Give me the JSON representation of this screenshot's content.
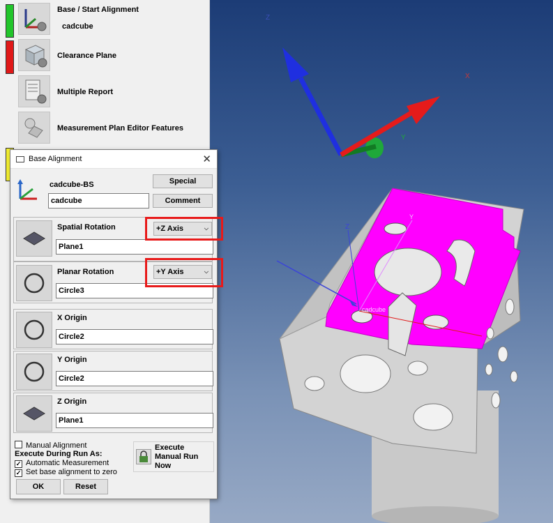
{
  "plan_editor": {
    "items": [
      {
        "label": "Base / Start Alignment",
        "sublabel": "cadcube",
        "status_color": "#22c52b",
        "icon": "alignment-axes-icon"
      },
      {
        "label": "Clearance Plane",
        "status_color": "#e01818",
        "icon": "clearance-cube-icon"
      },
      {
        "label": "Multiple Report",
        "icon": "report-icon"
      },
      {
        "label": "Measurement Plan Editor Features",
        "icon": "features-icon"
      }
    ],
    "hidden_status_color": "#f2ee30"
  },
  "dialog": {
    "title": "Base Alignment",
    "alignment_name": "cadcube-BS",
    "comment_value": "cadcube",
    "special_button": "Special",
    "comment_button": "Comment",
    "spatial_rotation": {
      "label": "Spatial Rotation",
      "axis": "+Z Axis",
      "feature": "Plane1",
      "icon": "plane-icon"
    },
    "planar_rotation": {
      "label": "Planar Rotation",
      "axis": "+Y Axis",
      "feature": "Circle3",
      "icon": "circle-icon"
    },
    "x_origin": {
      "label": "X Origin",
      "feature": "Circle2",
      "icon": "circle-icon"
    },
    "y_origin": {
      "label": "Y Origin",
      "feature": "Circle2",
      "icon": "circle-icon"
    },
    "z_origin": {
      "label": "Z Origin",
      "feature": "Plane1",
      "icon": "plane-icon"
    },
    "manual_alignment": {
      "label": "Manual Alignment",
      "checked": false
    },
    "execute_label": "Execute During Run As:",
    "automatic_measurement": {
      "label": "Automatic Measurement",
      "checked": true
    },
    "set_base_zero": {
      "label": "Set base alignment to zero",
      "checked": true
    },
    "execute_manual": {
      "line1": "Execute",
      "line2": "Manual Run",
      "line3": "Now"
    },
    "ok_button": "OK",
    "reset_button": "Reset"
  },
  "viewport": {
    "axis_z": "Z",
    "axis_x": "X",
    "axis_y": "Y",
    "part_label": "cadcube",
    "part_z": "Z",
    "part_y": "Y",
    "colors": {
      "selected_face": "#ff00ff",
      "part": "#d6d6d6",
      "z_axis": "#1f2fe0",
      "x_axis": "#e51b1b",
      "y_axis": "#1fa83a"
    }
  }
}
